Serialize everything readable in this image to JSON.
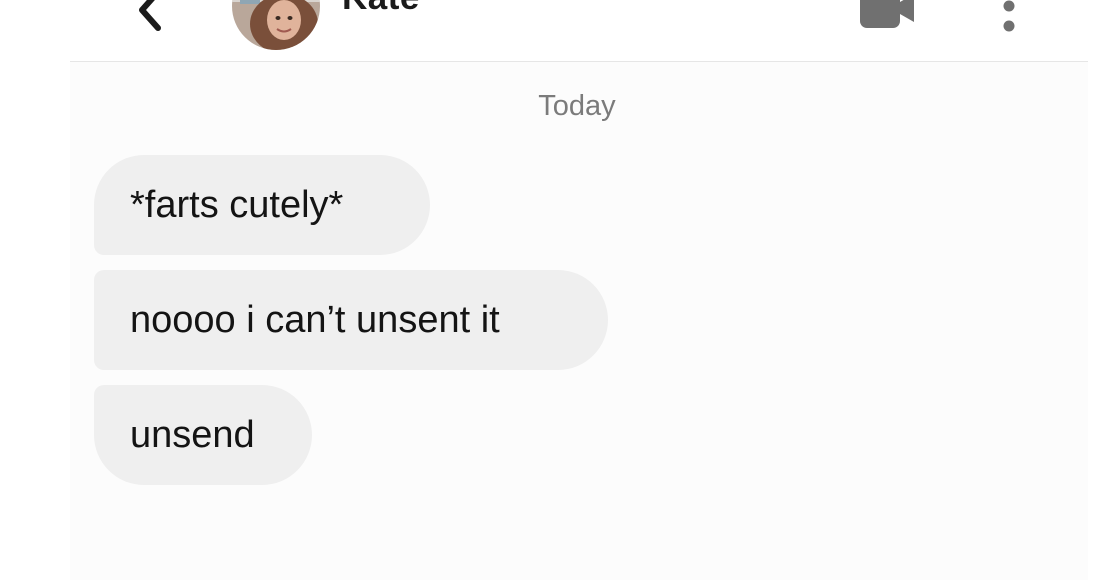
{
  "header": {
    "contact_name": "Kate",
    "icons": {
      "back": "chevron-left-icon",
      "video": "video-camera-icon",
      "more": "more-vertical-icon"
    }
  },
  "chat": {
    "date_separator": "Today",
    "messages": [
      {
        "text": "*farts cutely*"
      },
      {
        "text": "noooo i can’t unsent it"
      },
      {
        "text": "unsend"
      }
    ]
  },
  "colors": {
    "bubble_bg": "#efefef",
    "text": "#141414",
    "muted": "#7b7b7b"
  }
}
